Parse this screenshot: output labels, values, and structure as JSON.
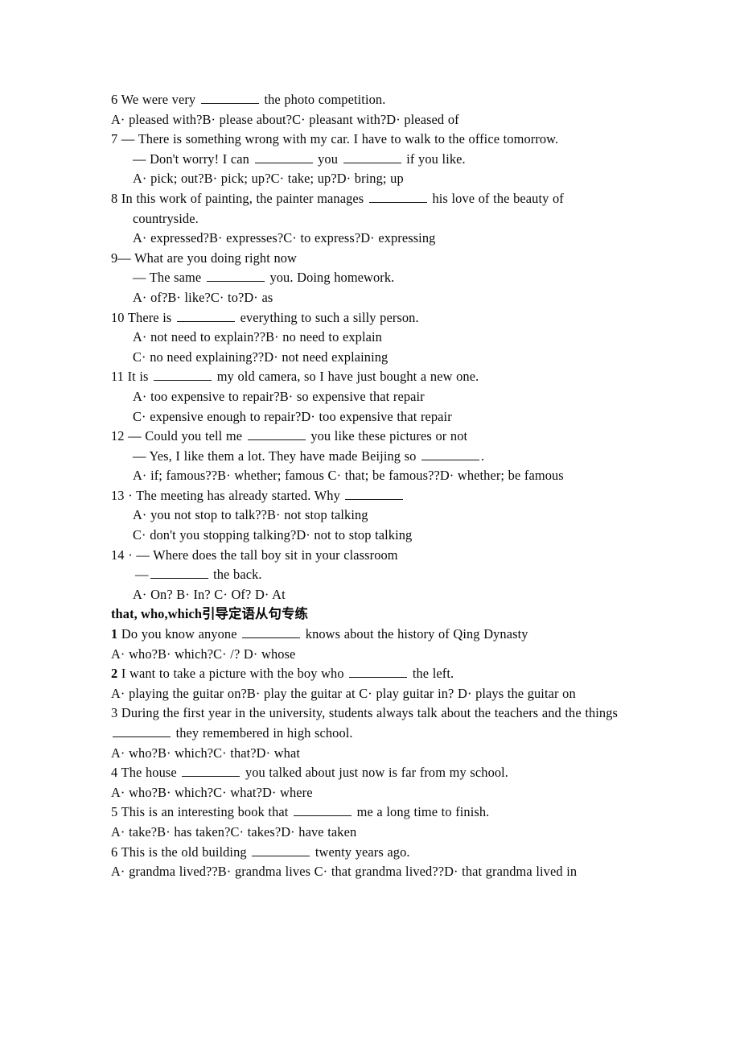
{
  "document": {
    "type": "english-grammar-worksheet",
    "page_background": "#ffffff",
    "text_color": "#0a0a0a"
  },
  "section_one": {
    "questions": [
      {
        "id": "q6",
        "number": "6",
        "stem_before": "We were very",
        "stem_after": "the photo competition.",
        "options": "A· pleased with?B· please about?C· pleasant with?D· pleased of"
      },
      {
        "id": "q7",
        "number": "7",
        "line1": "— There is something wrong with my car. I have to walk to the office tomorrow.",
        "line2_before": "— Don't worry! I can",
        "line2_mid": "you",
        "line2_after": "if you like.",
        "options": "A· pick; out?B· pick; up?C· take; up?D· bring; up"
      },
      {
        "id": "q8",
        "number": "8",
        "stem_before": "In this work of painting, the painter manages",
        "stem_after": "his love of the beauty of countryside.",
        "options": "A· expressed?B· expresses?C· to express?D· expressing"
      },
      {
        "id": "q9",
        "number": "9",
        "line1": "— What are you doing right now",
        "line2_before": "— The same",
        "line2_after": "you. Doing homework.",
        "options": "A· of?B· like?C· to?D· as"
      },
      {
        "id": "q10",
        "number": "10",
        "stem_before": "There is",
        "stem_after": "everything to such a silly person.",
        "options_a": "A· not need to explain??B· no need to explain",
        "options_b": "C· no need explaining??D· not need explaining"
      },
      {
        "id": "q11",
        "number": "11",
        "stem_before": "It is",
        "stem_after": "my old camera, so I have just bought a new one.",
        "options_a": "A· too expensive to repair?B· so expensive that repair",
        "options_b": "C· expensive enough to repair?D· too expensive that repair"
      },
      {
        "id": "q12",
        "number": "12",
        "line1_before": "— Could you tell me",
        "line1_after": "you like these pictures or not",
        "line2_before": "— Yes, I like them a lot. They have made Beijing so",
        "line2_after": ".",
        "options": "A· if; famous??B· whether; famous  C· that; be famous??D· whether; be famous"
      },
      {
        "id": "q13",
        "number": "13",
        "stem_before": "· The meeting has already started. Why",
        "options_a": "A· you not stop to talk??B· not stop talking",
        "options_b": "C· don't you stopping talking?D· not to stop talking"
      },
      {
        "id": "q14",
        "number": "14",
        "line1": "· — Where does the tall boy sit in your classroom",
        "line2_before": "—",
        "line2_after": "the back.",
        "options": "A· On? B· In? C· Of? D· At"
      }
    ]
  },
  "section_two": {
    "heading": "that, who,which引导定语从句专练",
    "questions": [
      {
        "id": "s2q1",
        "number": "1",
        "stem_before": "Do you know anyone",
        "stem_after": "knows about the history of Qing Dynasty",
        "options": "A· who?B· which?C· /? D· whose"
      },
      {
        "id": "s2q2",
        "number": "2",
        "stem_before": "I want to take a picture with the boy who",
        "stem_after": "the left.",
        "options": "A· playing the guitar on?B· play the guitar at  C· play guitar in?  D· plays the guitar on"
      },
      {
        "id": "s2q3",
        "number": "3",
        "stem_before": "During the first year in the university, students always talk about the teachers and the things",
        "stem_after": "they remembered in high school.",
        "options": "A· who?B· which?C· that?D· what"
      },
      {
        "id": "s2q4",
        "number": "4",
        "stem_before": "The house",
        "stem_after": "you talked about just now is far from my school.",
        "options": "A· who?B· which?C· what?D· where"
      },
      {
        "id": "s2q5",
        "number": "5",
        "stem_before": "This is an interesting book that",
        "stem_after": "me a long time to finish.",
        "options": "A· take?B· has taken?C· takes?D· have taken"
      },
      {
        "id": "s2q6",
        "number": "6",
        "stem_before": "This is the old building",
        "stem_after": "twenty years ago.",
        "options": "A· grandma lived??B· grandma lives  C· that grandma lived??D· that grandma lived in"
      }
    ]
  }
}
